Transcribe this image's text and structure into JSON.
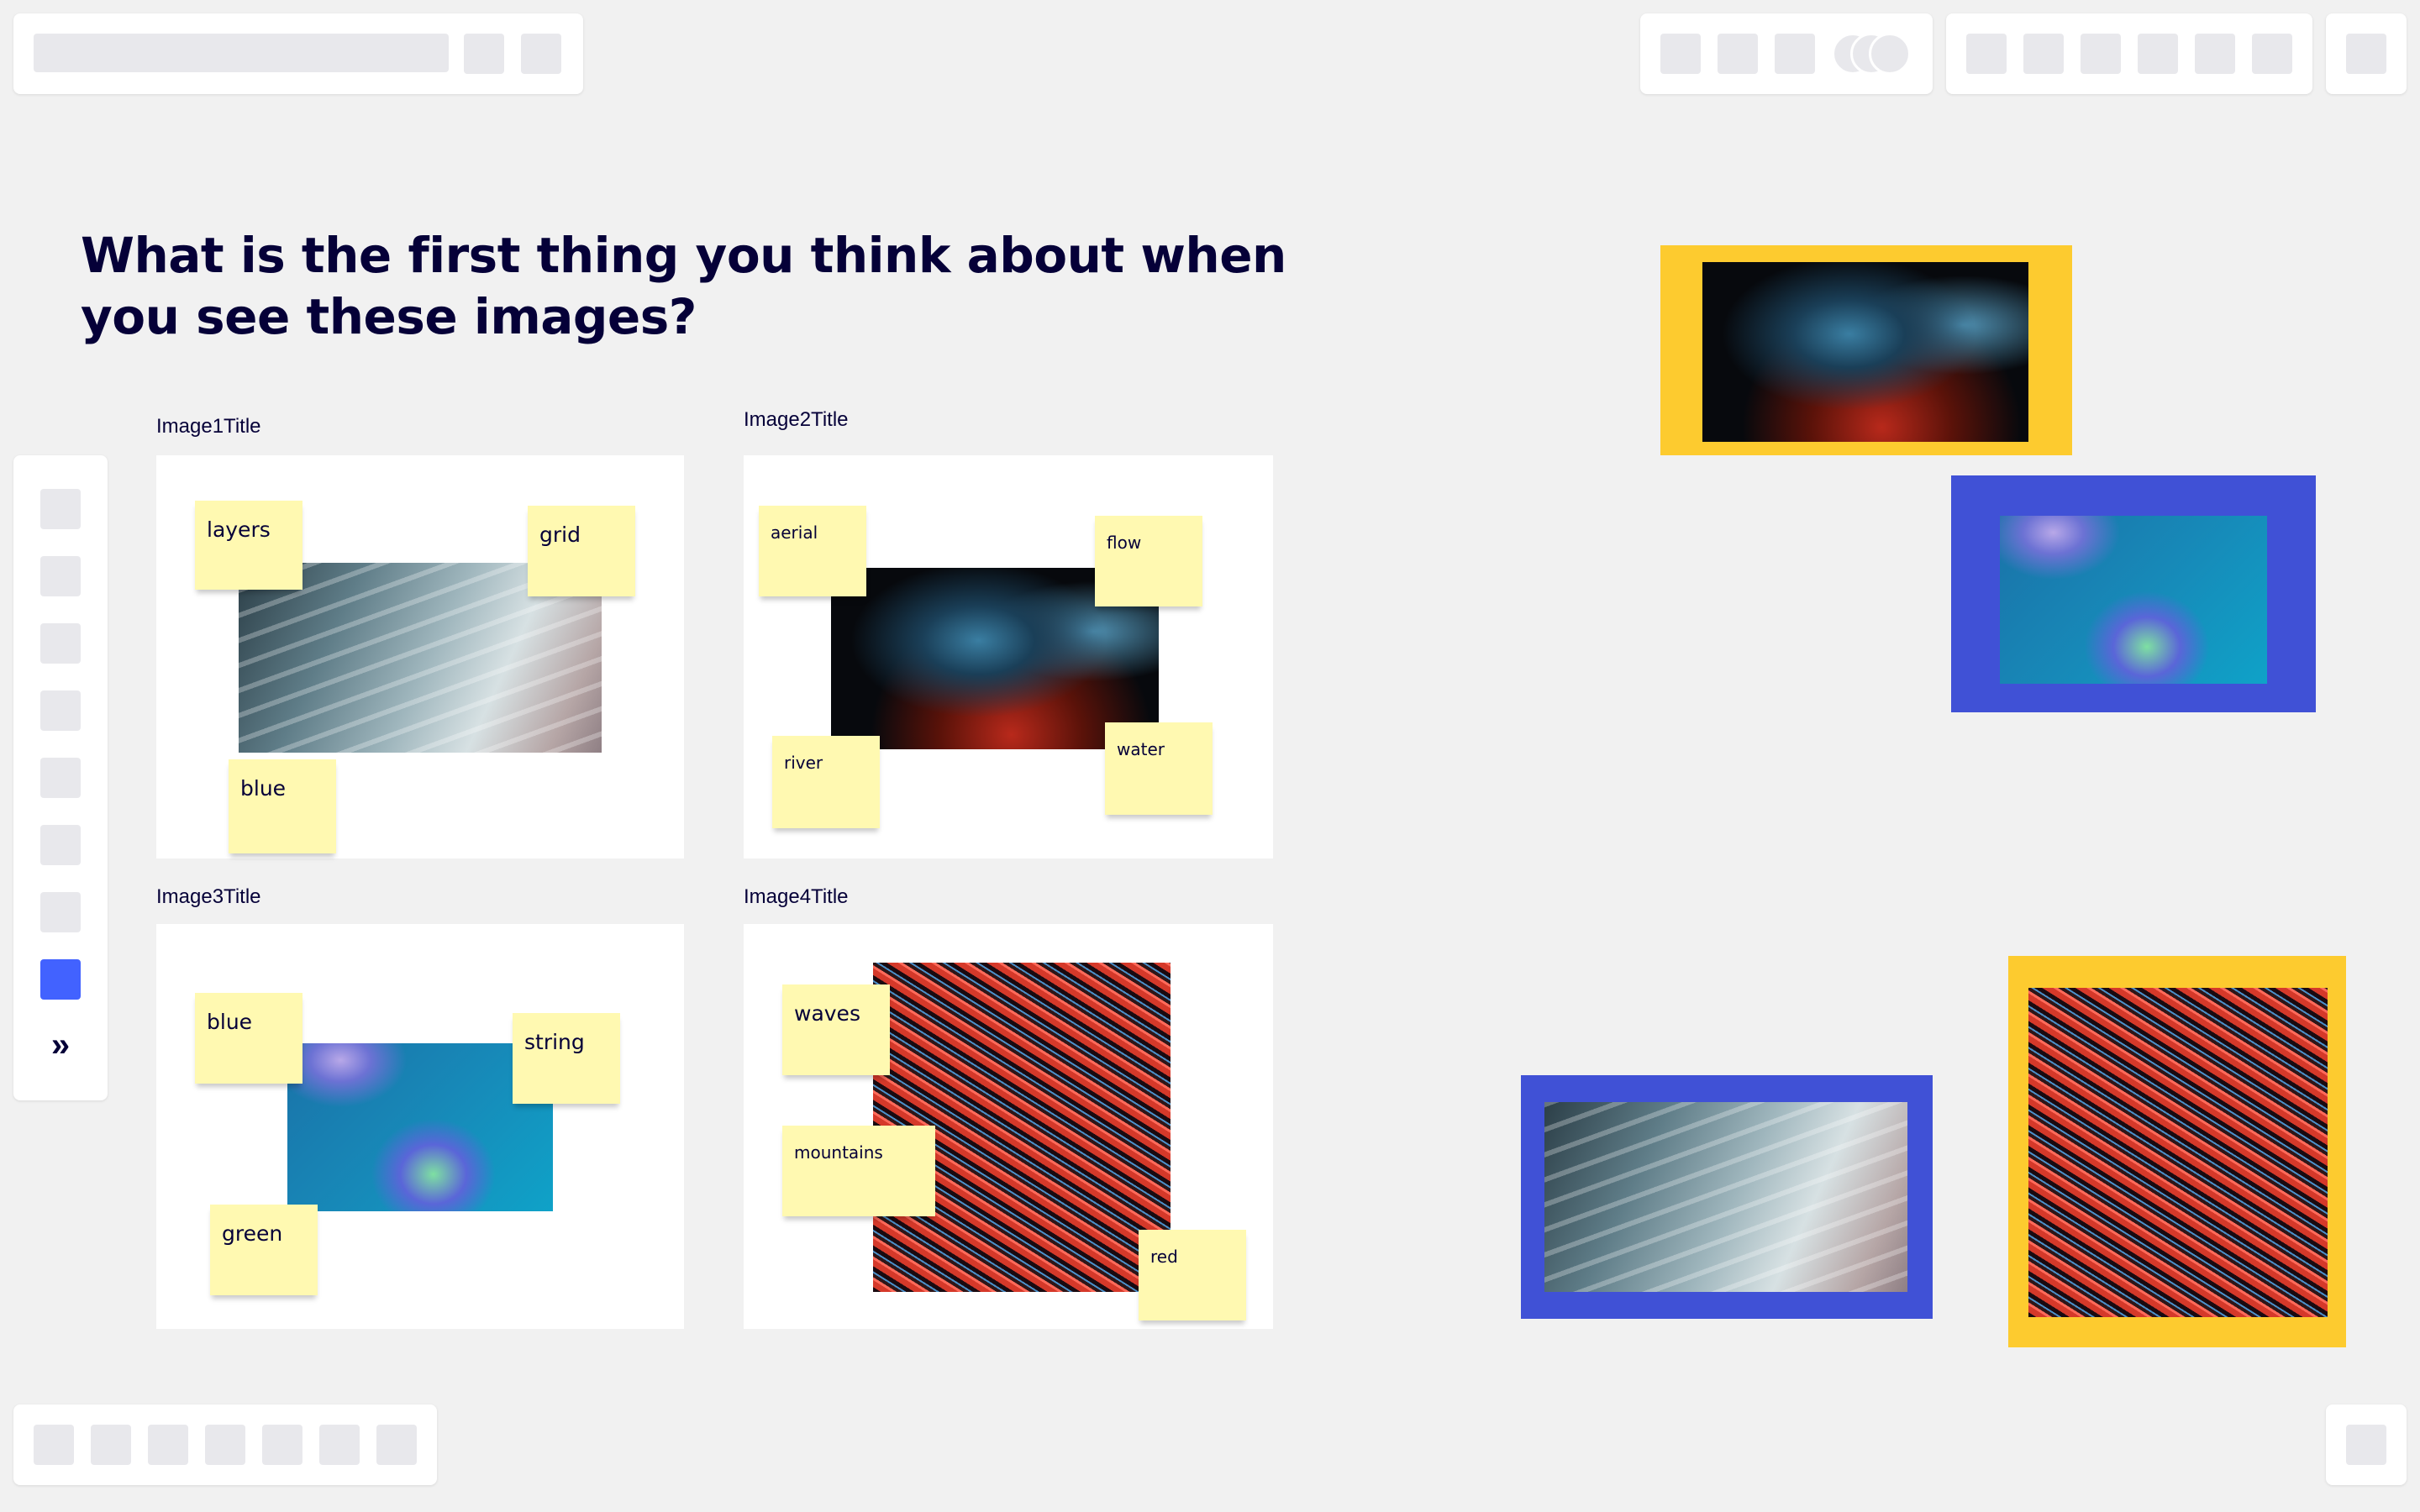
{
  "board": {
    "question": "What is the first thing you think about when you see these images?"
  },
  "frames": [
    {
      "title": "Image1Title",
      "stickies": [
        "layers",
        "grid",
        "blue"
      ]
    },
    {
      "title": "Image2Title",
      "stickies": [
        "aerial",
        "flow",
        "river",
        "water"
      ]
    },
    {
      "title": "Image3Title",
      "stickies": [
        "blue",
        "string",
        "green"
      ]
    },
    {
      "title": "Image4Title",
      "stickies": [
        "waves",
        "mountains",
        "red"
      ]
    }
  ],
  "left_toolbar": {
    "expand_label": "»",
    "active_color": "#4262ff"
  },
  "colors": {
    "canvas": "#f1f1f1",
    "sticky": "#fff9b1",
    "frame_yellow": "#fdcb2f",
    "frame_blue": "#4051d6",
    "text": "#050038"
  }
}
